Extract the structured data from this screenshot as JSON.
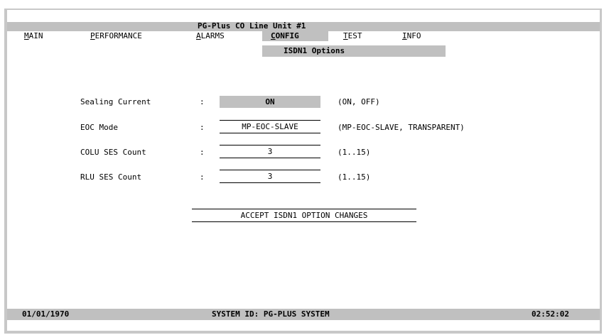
{
  "header": {
    "title": "PG-Plus CO Line Unit #1"
  },
  "menu": [
    {
      "accel": "M",
      "rest": "AIN"
    },
    {
      "accel": "P",
      "rest": "ERFORMANCE"
    },
    {
      "accel": "A",
      "rest": "LARMS"
    },
    {
      "accel": "C",
      "rest": "ONFIG"
    },
    {
      "accel": "T",
      "rest": "EST"
    },
    {
      "accel": "I",
      "rest": "NFO"
    }
  ],
  "submenu": {
    "label": "ISDN1 Options"
  },
  "fields": {
    "sealing_current": {
      "label": "Sealing Current",
      "sep": ":",
      "value": "ON",
      "range": "(ON, OFF)"
    },
    "eoc_mode": {
      "label": "EOC Mode",
      "sep": ":",
      "value": "MP-EOC-SLAVE",
      "range": "(MP-EOC-SLAVE, TRANSPARENT)"
    },
    "colu_ses": {
      "label": "COLU SES Count",
      "sep": ":",
      "value": "3",
      "range": "(1..15)"
    },
    "rlu_ses": {
      "label": "RLU SES Count",
      "sep": ":",
      "value": "3",
      "range": "(1..15)"
    }
  },
  "accept_button": {
    "label": "ACCEPT ISDN1 OPTION CHANGES"
  },
  "status": {
    "date": "01/01/1970",
    "system_id": "SYSTEM ID: PG-PLUS SYSTEM",
    "time": "02:52:02"
  },
  "colors": {
    "bar": "#c0c0c0",
    "frame": "#c8c8c8",
    "background": "#ffffff",
    "text": "#000000"
  }
}
